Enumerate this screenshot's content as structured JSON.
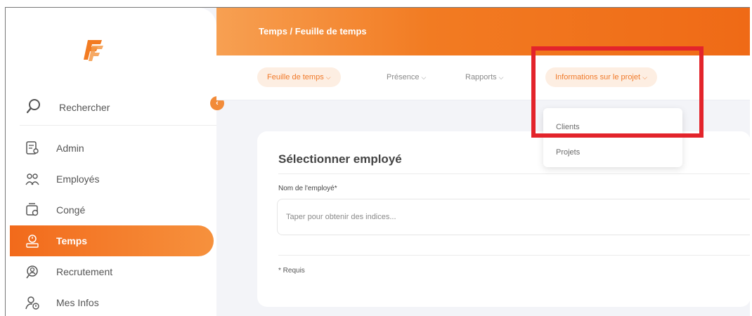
{
  "breadcrumb": "Temps / Feuille de temps",
  "sidebar": {
    "search_label": "Rechercher",
    "collapse_glyph": "‹",
    "items": [
      {
        "label": "Admin",
        "icon": "admin-icon"
      },
      {
        "label": "Employés",
        "icon": "employees-icon"
      },
      {
        "label": "Congé",
        "icon": "leave-icon"
      },
      {
        "label": "Temps",
        "icon": "time-icon",
        "active": true
      },
      {
        "label": "Recrutement",
        "icon": "recruitment-icon"
      },
      {
        "label": "Mes Infos",
        "icon": "my-info-icon"
      }
    ]
  },
  "tabs": [
    {
      "label": "Feuille de temps",
      "chevron": "⌵"
    },
    {
      "label": "Présence",
      "chevron": "⌵"
    },
    {
      "label": "Rapports",
      "chevron": "⌵"
    },
    {
      "label": "Informations sur le projet",
      "chevron": "⌵"
    }
  ],
  "dropdown": {
    "items": [
      "Clients",
      "Projets"
    ]
  },
  "card": {
    "title": "Sélectionner employé",
    "field_label": "Nom de l'employé*",
    "placeholder": "Taper pour obtenir des indices...",
    "required_note": "* Requis"
  },
  "colors": {
    "accent": "#f27b22",
    "highlight": "#e3242b"
  }
}
